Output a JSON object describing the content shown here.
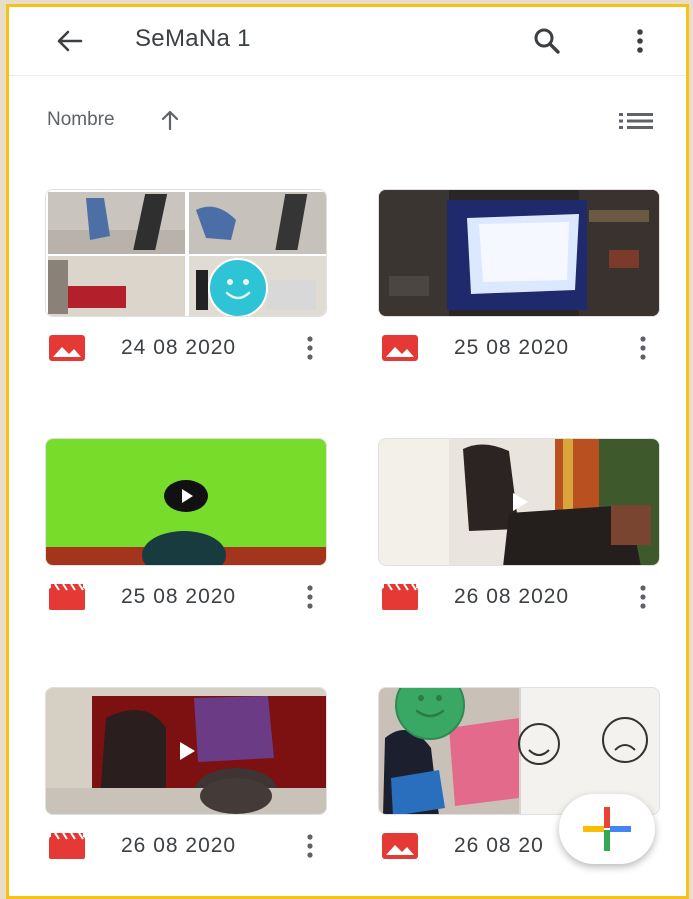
{
  "app_bar": {
    "title": "SeMaNa 1",
    "back_icon": "arrow-back-icon",
    "search_icon": "search-icon",
    "more_icon": "more-vert-icon"
  },
  "sort": {
    "label": "Nombre",
    "direction_icon": "arrow-upward-icon",
    "view_icon": "list-view-icon"
  },
  "items": [
    {
      "date": "24 08 2020",
      "type": "image"
    },
    {
      "date": "25 08 2020",
      "type": "image"
    },
    {
      "date": "25 08 2020",
      "type": "video"
    },
    {
      "date": "26 08 2020",
      "type": "video"
    },
    {
      "date": "26 08 2020",
      "type": "video"
    },
    {
      "date": "26 08 20",
      "type": "image"
    }
  ],
  "fab": {
    "icon": "plus-icon"
  },
  "colors": {
    "frame": "#f6c21a",
    "file_icon_red": "#e53935",
    "sticker_teal": "#2ec4d6",
    "sticker_green": "#3aa865"
  }
}
